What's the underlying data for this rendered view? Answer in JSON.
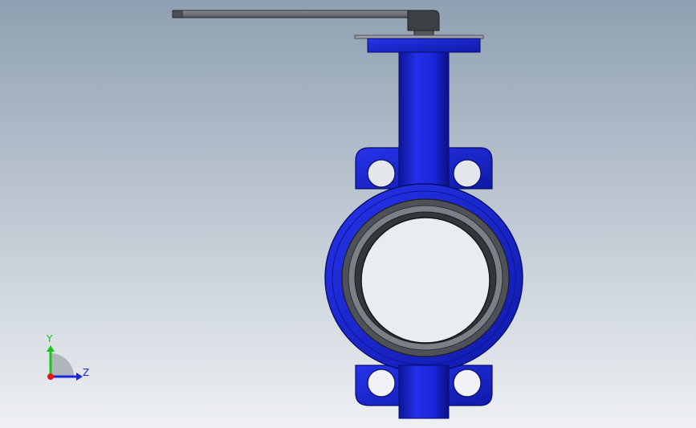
{
  "colors": {
    "background_top": "#8fa0b2",
    "background_bottom": "#eef0f3",
    "valve_body": "#1a26d8",
    "valve_body_dark": "#0a1390",
    "liner": "#5a5f66",
    "liner_dark": "#2a2d31",
    "handle": "#6d7075",
    "handle_dark": "#2b2d30",
    "axis_y": "#14c814",
    "axis_z": "#1a26d8",
    "axis_origin": "#e01818"
  },
  "axes": {
    "y_label": "Y",
    "z_label": "Z"
  }
}
